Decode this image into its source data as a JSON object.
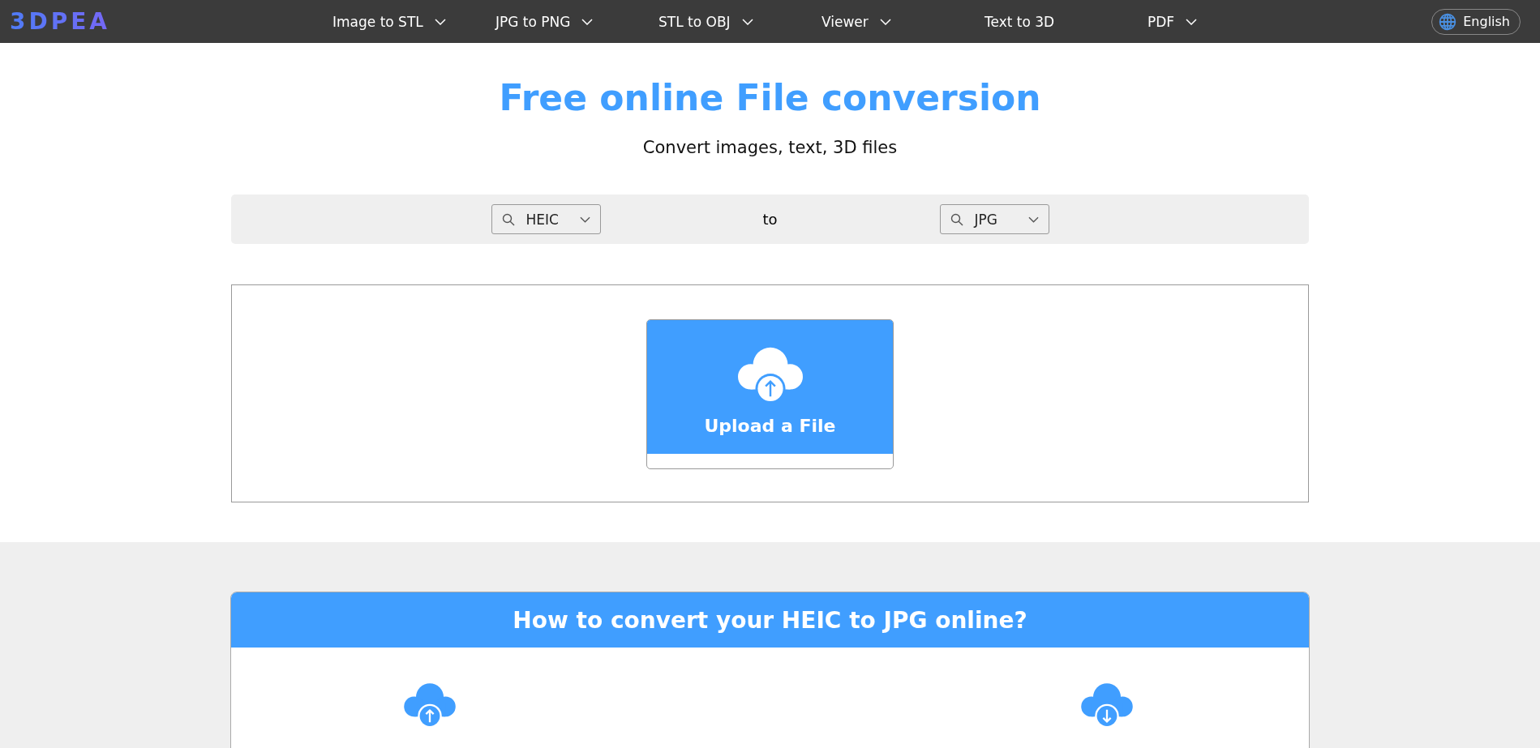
{
  "header": {
    "logo": "3DPEA",
    "nav": [
      {
        "label": "Image to STL",
        "dropdown": true
      },
      {
        "label": "JPG to PNG",
        "dropdown": true
      },
      {
        "label": "STL to OBJ",
        "dropdown": true
      },
      {
        "label": "Viewer",
        "dropdown": true
      },
      {
        "label": "Text to 3D",
        "dropdown": false
      },
      {
        "label": "PDF",
        "dropdown": true
      }
    ],
    "language": "English"
  },
  "hero": {
    "title": "Free online File conversion",
    "subtitle": "Convert images, text, 3D files"
  },
  "converter": {
    "from": "HEIC",
    "separator": "to",
    "to": "JPG"
  },
  "upload": {
    "button": "Upload a File"
  },
  "howto": {
    "title": "How to convert your HEIC to JPG online?",
    "steps": [
      {
        "kind": "upload"
      },
      {
        "kind": "download"
      }
    ]
  }
}
